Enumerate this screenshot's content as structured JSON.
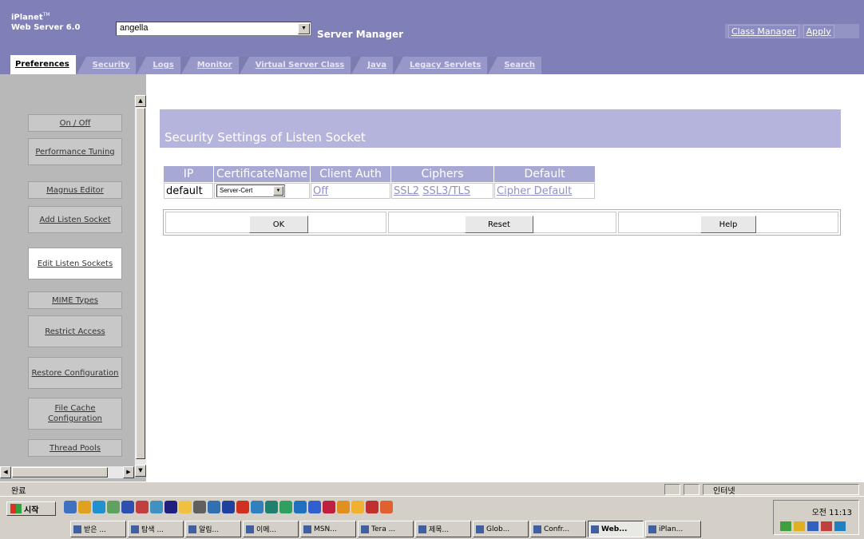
{
  "header": {
    "product_name": "iPlanet",
    "product_tm": "TM",
    "product_version": "Web Server 6.0",
    "server_select_value": "angella",
    "manager_title": "Server Manager",
    "links": [
      "Class Manager",
      "Apply"
    ]
  },
  "tabs": [
    {
      "label": "Preferences",
      "active": true
    },
    {
      "label": "Security"
    },
    {
      "label": "Logs"
    },
    {
      "label": "Monitor"
    },
    {
      "label": "Virtual Server Class"
    },
    {
      "label": "Java"
    },
    {
      "label": "Legacy Servlets"
    },
    {
      "label": "Search"
    }
  ],
  "sidebar": {
    "items": [
      {
        "label": "On / Off"
      },
      {
        "label": "Performance Tuning"
      },
      {
        "label": "Magnus Editor"
      },
      {
        "label": "Add Listen Socket"
      },
      {
        "label": "Edit Listen Sockets",
        "active": true
      },
      {
        "label": "MIME Types"
      },
      {
        "label": "Restrict Access"
      },
      {
        "label": "Restore Configuration"
      },
      {
        "label": "File Cache Configuration"
      },
      {
        "label": "Thread Pools"
      }
    ]
  },
  "content": {
    "title": "Security Settings of Listen Socket",
    "table": {
      "headers": [
        "IP",
        "CertificateName",
        "Client Auth",
        "Ciphers",
        "Default"
      ],
      "row": {
        "ip": "default",
        "certificate": "Server-Cert",
        "client_auth": "Off",
        "cipher_ssl2": "SSL2",
        "cipher_ssl3": "SSL3/TLS",
        "default": "Cipher Default"
      }
    },
    "buttons": {
      "ok": "OK",
      "reset": "Reset",
      "help": "Help"
    }
  },
  "statusbar": {
    "status": "완료",
    "zone": "인터넷"
  },
  "taskbar": {
    "start_label": "시작",
    "clock": "오전 11:13",
    "tasks": [
      "받은 ...",
      "탐색 ...",
      "알림...",
      "이메...",
      "MSN...",
      "Tera ...",
      "제목...",
      "Glob...",
      "Confr...",
      "Web...",
      "iPlan..."
    ]
  },
  "colors": {
    "banner": "#8080b8",
    "tab": "#9898c8",
    "table_header": "#a8a8d4",
    "link": "#9090c8"
  }
}
